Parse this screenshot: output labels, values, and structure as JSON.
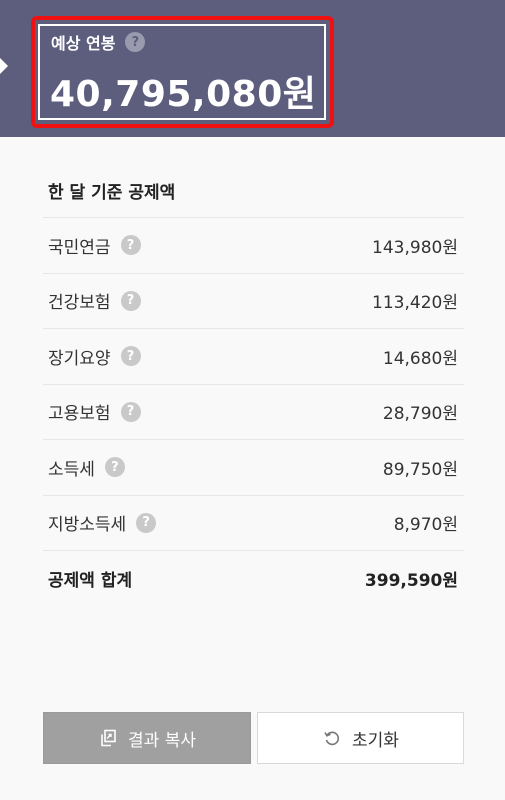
{
  "header": {
    "label": "예상 연봉",
    "help_icon": "?",
    "annual_salary": "40,795,080원"
  },
  "deductions": {
    "title": "한 달 기준 공제액",
    "items": [
      {
        "label": "국민연금",
        "value": "143,980원"
      },
      {
        "label": "건강보험",
        "value": "113,420원"
      },
      {
        "label": "장기요양",
        "value": "14,680원"
      },
      {
        "label": "고용보험",
        "value": "28,790원"
      },
      {
        "label": "소득세",
        "value": "89,750원"
      },
      {
        "label": "지방소득세",
        "value": "8,970원"
      }
    ],
    "total": {
      "label": "공제액 합계",
      "value": "399,590원"
    }
  },
  "buttons": {
    "copy_label": "결과 복사",
    "reset_label": "초기화"
  },
  "icons": {
    "help": "question-circle-icon",
    "copy": "copy-icon",
    "reset": "reset-icon"
  },
  "colors": {
    "header_bg": "#5d5e7e",
    "highlight": "#f01010",
    "copy_button_bg": "#a0a0a0"
  }
}
